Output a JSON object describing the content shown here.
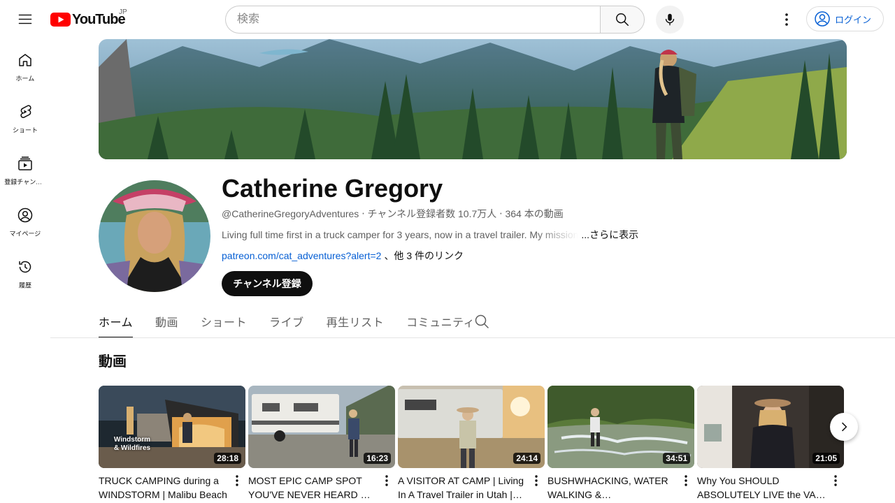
{
  "header": {
    "logo_text": "YouTube",
    "region": "JP",
    "search_placeholder": "検索",
    "signin_label": "ログイン"
  },
  "sidebar": {
    "items": [
      {
        "label": "ホーム",
        "icon": "home-icon"
      },
      {
        "label": "ショート",
        "icon": "shorts-icon"
      },
      {
        "label": "登録チャンネル",
        "icon": "subscriptions-icon"
      },
      {
        "label": "マイページ",
        "icon": "account-icon"
      },
      {
        "label": "履歴",
        "icon": "history-icon"
      }
    ]
  },
  "channel": {
    "name": "Catherine Gregory",
    "meta": "@CatherineGregoryAdventures ‧ チャンネル登録者数 10.7万人 ‧ 364 本の動画",
    "description": "Living full time first in a truck camper for 3 years, now in a travel trailer. My mission",
    "more_label": "...さらに表示",
    "link": "patreon.com/cat_adventures?alert=2",
    "other_links": "、他 3 件のリンク",
    "subscribe_label": "チャンネル登録"
  },
  "tabs": [
    {
      "label": "ホーム",
      "active": true
    },
    {
      "label": "動画",
      "active": false
    },
    {
      "label": "ショート",
      "active": false
    },
    {
      "label": "ライブ",
      "active": false
    },
    {
      "label": "再生リスト",
      "active": false
    },
    {
      "label": "コミュニティ",
      "active": false
    }
  ],
  "section": {
    "title": "動画",
    "videos": [
      {
        "title": "TRUCK CAMPING during a WINDSTORM | Malibu Beach",
        "duration": "28:18",
        "overlay": "Windstorm & Wildfires"
      },
      {
        "title": "MOST EPIC CAMP SPOT YOU'VE NEVER HEARD OF! | Free",
        "duration": "16:23"
      },
      {
        "title": "A VISITOR AT CAMP | Living In A Travel Trailer in Utah | Van",
        "duration": "24:14"
      },
      {
        "title": "BUSHWHACKING, WATER WALKING & BACKCOUNTRY CAMPING",
        "duration": "34:51"
      },
      {
        "title": "Why You SHOULD ABSOLUTELY LIVE the VAN LIFE",
        "duration": "21:05"
      }
    ]
  },
  "colors": {
    "brand_red": "#ff0000",
    "link_blue": "#065fd4",
    "text_primary": "#0f0f0f",
    "text_secondary": "#606060"
  }
}
